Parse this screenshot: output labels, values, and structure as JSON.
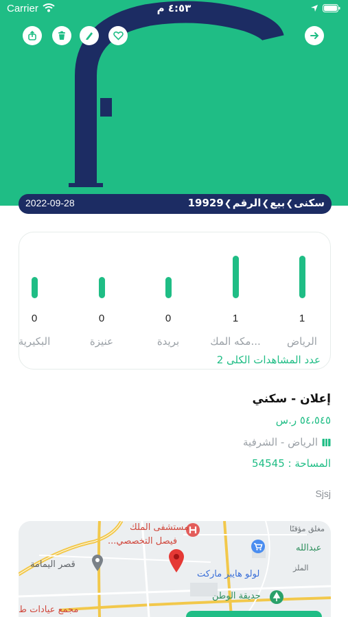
{
  "status_bar": {
    "carrier": "Carrier",
    "time": "٤:٥٣ م"
  },
  "hero": {
    "background_color": "#1fbd85",
    "logo_color": "#1c2c63",
    "actions": [
      {
        "name": "share",
        "icon": "share-icon"
      },
      {
        "name": "delete",
        "icon": "trash-icon"
      },
      {
        "name": "edit",
        "icon": "pencil-icon"
      },
      {
        "name": "favorite",
        "icon": "heart-icon"
      },
      {
        "name": "back",
        "icon": "arrow-right-icon"
      }
    ]
  },
  "breadcrumb": {
    "date": "2022-09-28",
    "items": [
      "سكنى",
      "بيع",
      "الرقم",
      "19929"
    ]
  },
  "views_chart": {
    "chart_data": {
      "type": "bar",
      "categories": [
        "الرياض",
        "مكه المك...",
        "بريدة",
        "عنيزة",
        "البكيرية"
      ],
      "values": [
        1,
        1,
        0,
        0,
        0
      ],
      "ylim": [
        0,
        1
      ]
    },
    "total_label": "عدد المشاهدات الكلى 2"
  },
  "listing": {
    "title": "إعلان - سكني",
    "price": "٥٤،٥٤٥ ر.س",
    "location": "الرياض - الشرفية",
    "area": "المساحة : 54545",
    "description": "Sjsj"
  },
  "map": {
    "labels": {
      "hospital": "مستشفى الملك",
      "hospital2": "فيصل التخصصي...",
      "closed": "مغلق مؤقتًا",
      "abdullah": "عبدالله",
      "malaz": "الملز",
      "palace": "قصر اليمامة",
      "lulu": "لولو هايبر ماركت",
      "park": "حديقة الوطن",
      "complex": "مجمع عيادات ط"
    }
  }
}
